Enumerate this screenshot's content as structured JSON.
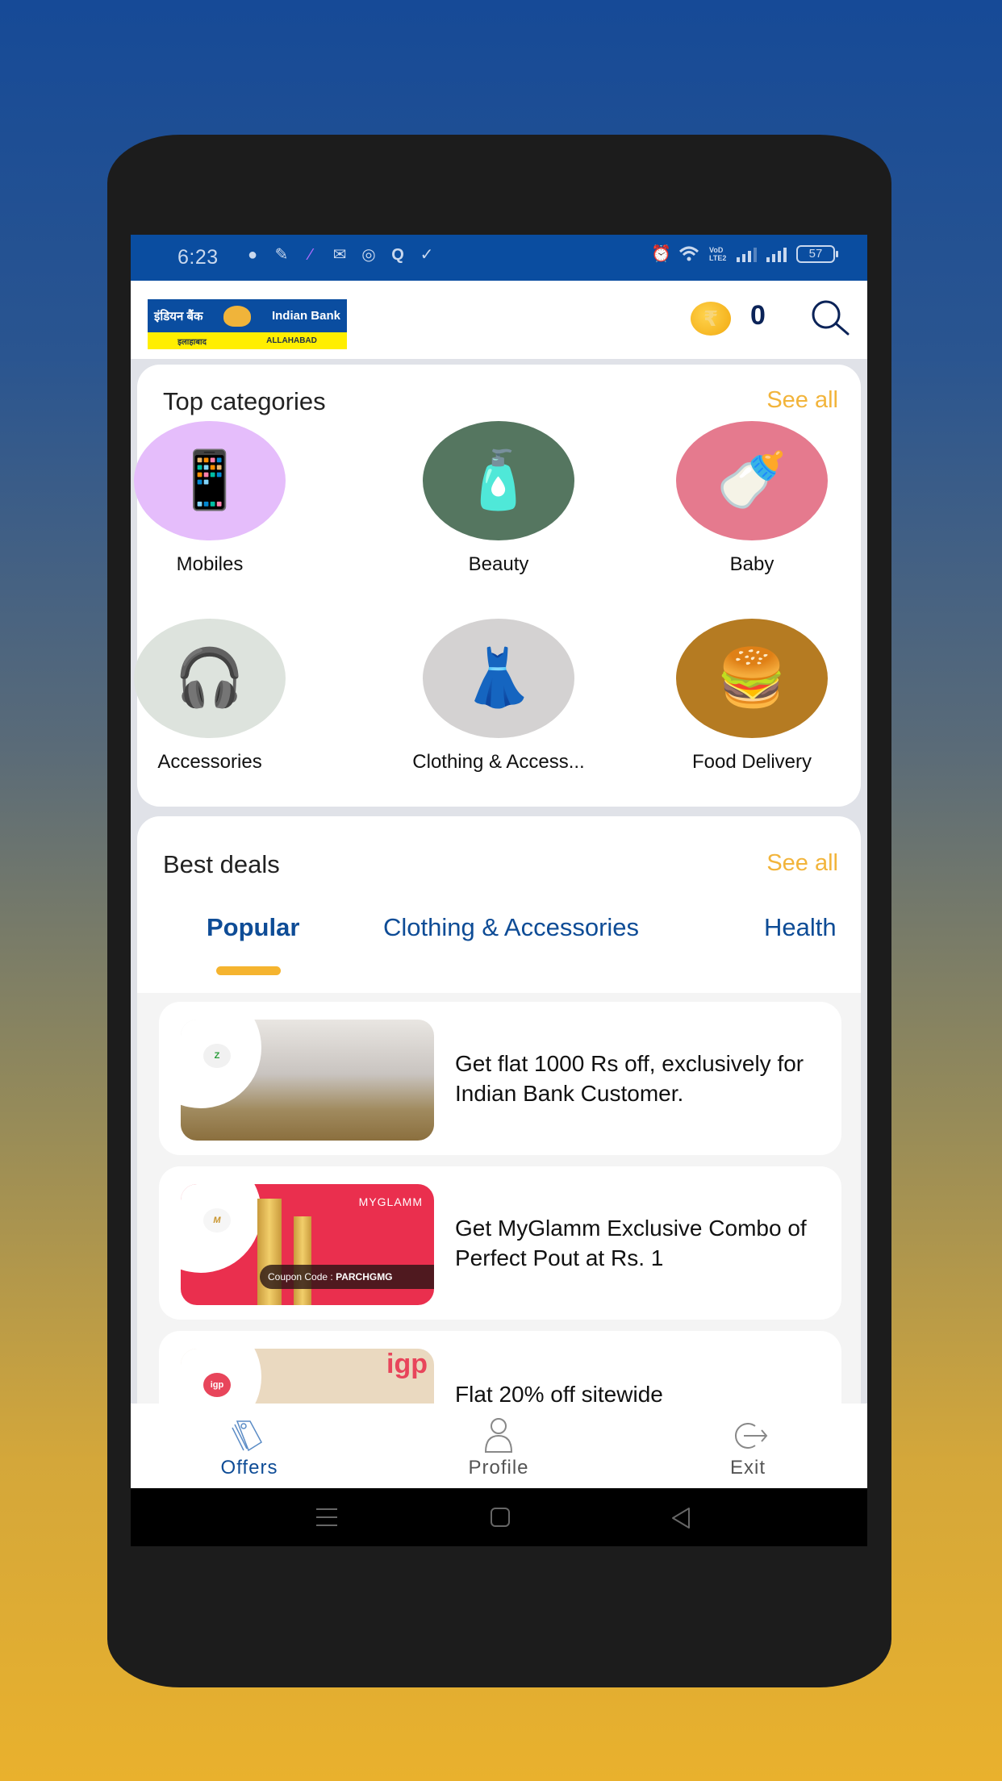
{
  "status_bar": {
    "time": "6:23",
    "notification_icons": [
      "chat-bubble-icon",
      "app-icon",
      "app-icon",
      "outlook-icon",
      "chrome-icon",
      "quora-icon",
      "check-icon"
    ],
    "system_icons": [
      "alarm-icon",
      "wifi-icon",
      "volte-icon",
      "signal-icon",
      "signal-icon"
    ],
    "volte_label": "VoD LTE2",
    "battery": "57"
  },
  "header": {
    "logo": {
      "hindi_name": "इंडियन बैंक",
      "english_name": "Indian Bank",
      "hindi_sub": "इलाहाबाद",
      "english_sub": "ALLAHABAD"
    },
    "coin_symbol": "₹",
    "coin_count": "0"
  },
  "top_categories": {
    "title": "Top categories",
    "see_all": "See all",
    "items": [
      {
        "label": "Mobiles",
        "color": "#e5bdfb",
        "emoji": "📱"
      },
      {
        "label": "Beauty",
        "color": "#557660",
        "emoji": "🧴"
      },
      {
        "label": "Baby",
        "color": "#e57a8e",
        "emoji": "🍼"
      },
      {
        "label": "Accessories",
        "color": "#dde3dd",
        "emoji": "🎧"
      },
      {
        "label": "Clothing & Access...",
        "color": "#d4d2d2",
        "emoji": "👗"
      },
      {
        "label": "Food Delivery",
        "color": "#b57b22",
        "emoji": "🍔"
      }
    ]
  },
  "best_deals": {
    "title": "Best deals",
    "see_all": "See all",
    "tabs": [
      {
        "label": "Popular",
        "active": true
      },
      {
        "label": "Clothing & Accessories",
        "active": false
      },
      {
        "label": "Health",
        "active": false
      }
    ],
    "offers": [
      {
        "text": "Get flat 1000 Rs off, exclusively for Indian Bank Customer.",
        "brand": "Zoomcar",
        "brand_logo_text": "Z"
      },
      {
        "text": "Get MyGlamm Exclusive Combo of Perfect Pout at Rs. 1",
        "brand": "MYGLAMM",
        "brand_logo_text": "M",
        "coupon_label": "Coupon Code :",
        "coupon_code": "PARCHGMG"
      },
      {
        "text": "Flat 20% off sitewide",
        "brand": "igp",
        "brand_logo_text": "igp"
      }
    ]
  },
  "bottom_nav": {
    "items": [
      {
        "label": "Offers",
        "icon": "tags-icon",
        "active": true
      },
      {
        "label": "Profile",
        "icon": "person-icon",
        "active": false
      },
      {
        "label": "Exit",
        "icon": "exit-icon",
        "active": false
      }
    ]
  },
  "system_nav": [
    "recents-button",
    "home-button",
    "back-button"
  ],
  "colors": {
    "primary_blue": "#0a4da0",
    "accent_yellow": "#f2b43b",
    "tab_text": "#0e4c96"
  }
}
